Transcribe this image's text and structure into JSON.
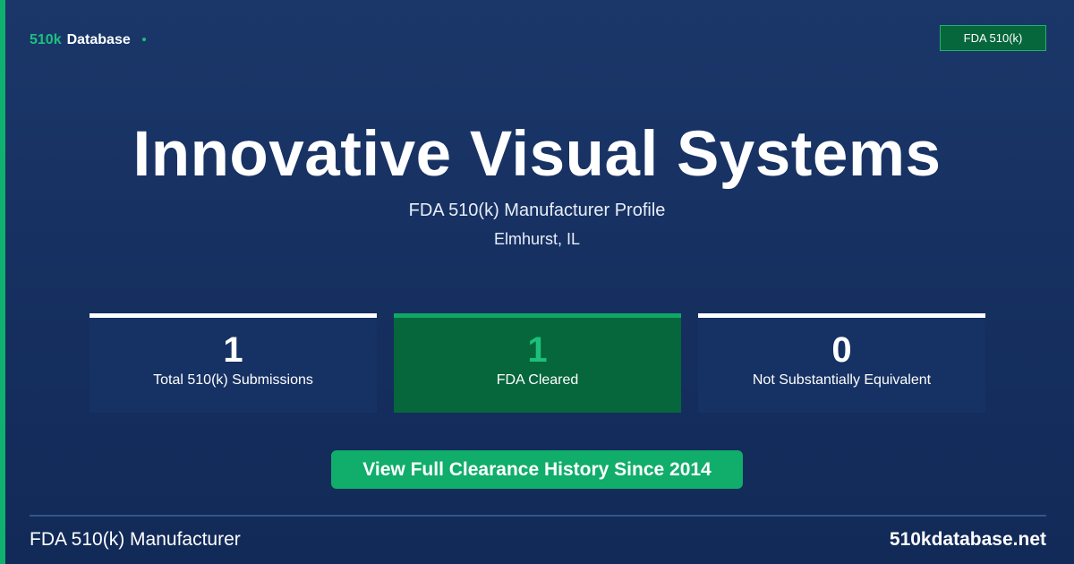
{
  "colors": {
    "background": "#163061",
    "accent": "#10b070",
    "brand_green": "#1cc07c",
    "card_dark": "#163163",
    "card_highlight": "#06663c"
  },
  "brand": {
    "highlight": "510k",
    "rest": "Database",
    "dot_icon": "dot-icon"
  },
  "badge": {
    "label": "FDA 510(k)"
  },
  "header": {
    "title": "Innovative Visual Systems",
    "subtitle": "FDA 510(k) Manufacturer Profile",
    "location": "Elmhurst, IL"
  },
  "stats": [
    {
      "value": "1",
      "label": "Total 510(k) Submissions"
    },
    {
      "value": "1",
      "label": "FDA Cleared"
    },
    {
      "value": "0",
      "label": "Not Substantially Equivalent"
    }
  ],
  "cta": {
    "label": "View Full Clearance History Since 2014"
  },
  "footer": {
    "left": "FDA 510(k) Manufacturer",
    "right": "510kdatabase.net"
  }
}
